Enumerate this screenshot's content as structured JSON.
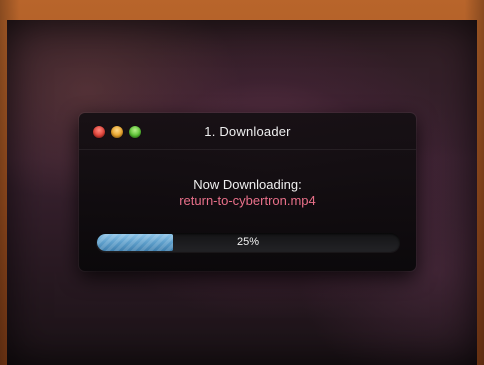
{
  "window": {
    "title": "1. Downloader",
    "controls": {
      "close_icon": "close-traffic-light",
      "minimize_icon": "minimize-traffic-light",
      "zoom_icon": "zoom-traffic-light"
    }
  },
  "download": {
    "heading": "Now Downloading:",
    "filename": "return-to-cybertron.mp4",
    "progress_fraction": 0.25,
    "progress_label": "25%"
  },
  "colors": {
    "filename": "#e9708a",
    "progress_fill": "#5e9fcb",
    "close": "#e0443a",
    "minimize": "#e8a42c",
    "zoom": "#5cc236"
  }
}
